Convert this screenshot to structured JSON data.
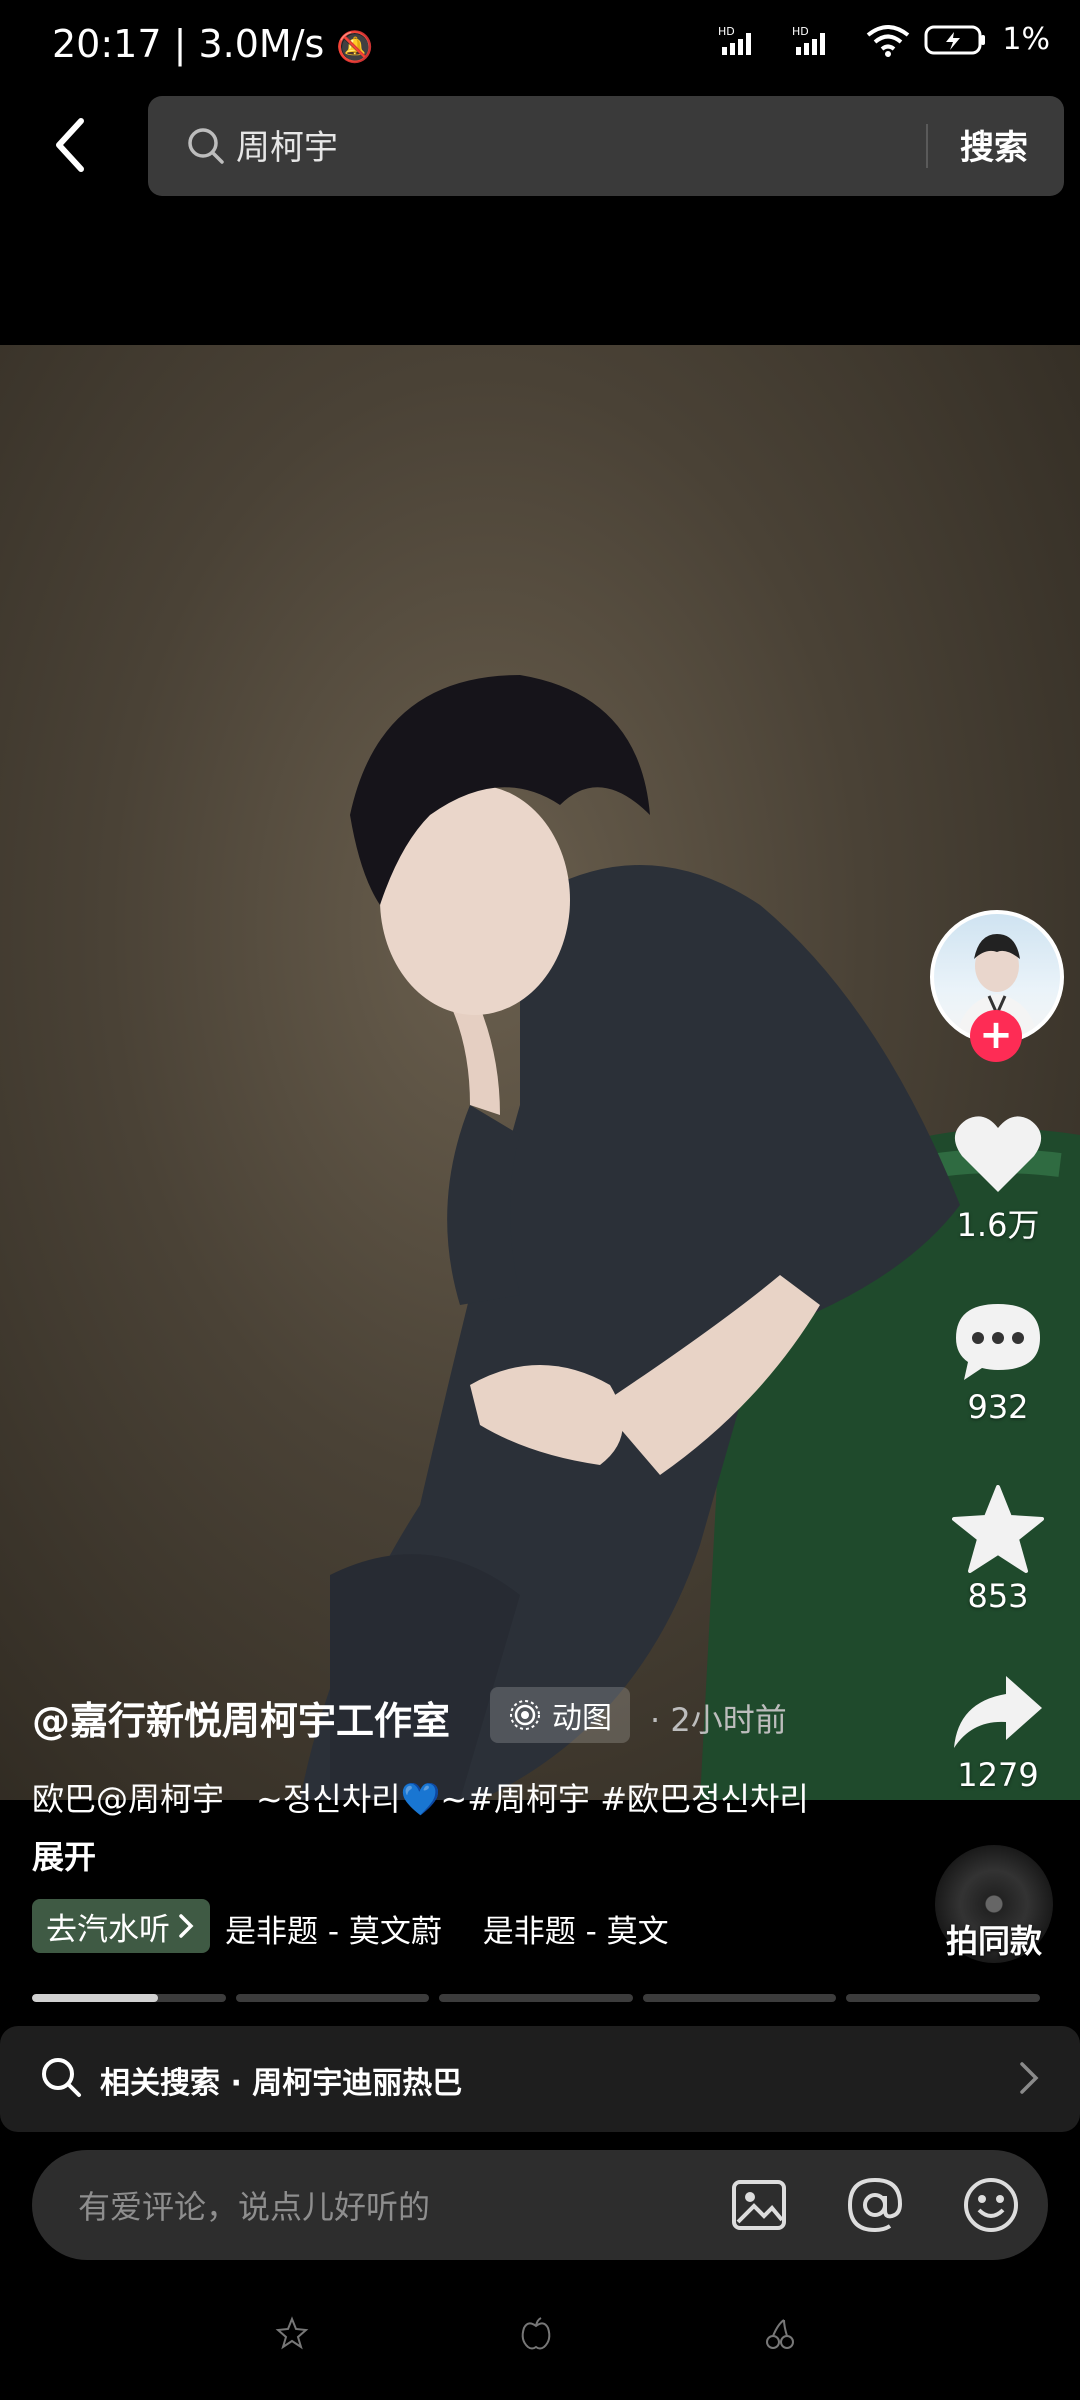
{
  "status_bar": {
    "time": "20:17",
    "speed": "3.0M/s",
    "battery": "1%"
  },
  "search": {
    "query": "周柯宇",
    "button": "搜索"
  },
  "right_rail": {
    "like_count": "1.6万",
    "comment_count": "932",
    "favorite_count": "853",
    "share_count": "1279",
    "follow_symbol": "+"
  },
  "post": {
    "author": "@嘉行新悦周柯宇工作室",
    "type_label": "动图",
    "time_ago": "· 2小时前",
    "description": "欧巴@周柯宇　~정신차리💙~#周柯宇 #欧巴정신차리",
    "expand_label": "展开",
    "music_chip": "去汽水听",
    "music_title": "是非题 - 莫文蔚　 是非题 - 莫文",
    "same_style": "拍同款"
  },
  "progress": {
    "segments": 5,
    "current_segment_fraction": 0.65
  },
  "related": {
    "text": "相关搜索 · 周柯宇迪丽热巴"
  },
  "comment_input": {
    "placeholder": "有爱评论，说点儿好听的"
  },
  "colors": {
    "accent": "#fe2c55",
    "music_chip": "#3f5a44",
    "search_bg": "#3a3a3a"
  }
}
